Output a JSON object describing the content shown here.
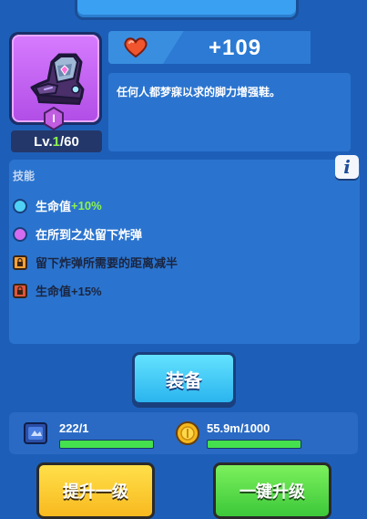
{
  "item": {
    "level_prefix": "Lv.",
    "level_current": "1",
    "level_max": "/60",
    "rank_label": "I",
    "icon": "magic-boot-icon"
  },
  "stat": {
    "icon": "heart-icon",
    "value": "+109"
  },
  "description": "任何人都梦寐以求的脚力增强鞋。",
  "skills": {
    "title": "技能",
    "items": [
      {
        "text": "生命值",
        "bonus": "+10%",
        "marker": "cyan-dot",
        "color": "#4fd0f5"
      },
      {
        "text": "在所到之处留下炸弹",
        "bonus": "",
        "marker": "purple-dot",
        "color": "#d36cf0"
      },
      {
        "text": "留下炸弹所需要的距离减半",
        "bonus": "",
        "marker": "orange-lock",
        "color": "#f3a23a"
      },
      {
        "text": "生命值+15%",
        "bonus": "",
        "marker": "red-lock",
        "color": "#e0553c"
      }
    ]
  },
  "info_label": "i",
  "equip_label": "装备",
  "resources": {
    "scroll": {
      "icon": "scroll-icon",
      "value": "222/1",
      "fill": 1.0
    },
    "coin": {
      "icon": "coin-icon",
      "value": "55.9m/1000",
      "fill": 1.0
    }
  },
  "buttons": {
    "upgrade_one": "提升一级",
    "upgrade_all": "一键升级"
  },
  "colors": {
    "background": "#1d5fb8",
    "panel": "#2a74cf",
    "accent_green": "#8df250",
    "progress_green": "#45e04e"
  }
}
